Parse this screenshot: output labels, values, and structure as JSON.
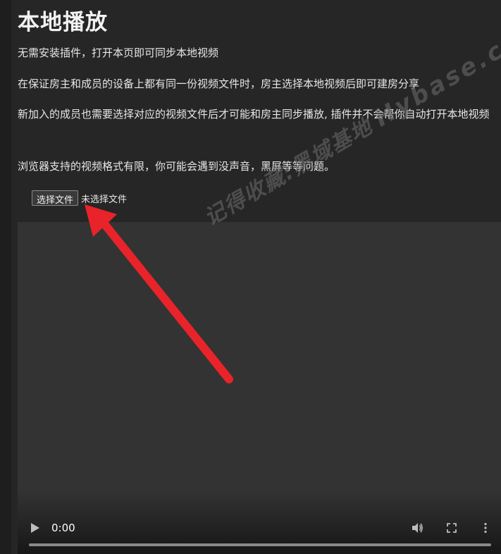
{
  "page": {
    "title": "本地播放",
    "paragraphs": [
      "无需安装插件，打开本页即可同步本地视频",
      "在保证房主和成员的设备上都有同一份视频文件时，房主选择本地视频后即可建房分享",
      "新加入的成员也需要选择对应的视频文件后才可能和房主同步播放, 插件并不会帮你自动打开本地视频",
      "浏览器支持的视频格式有限，你可能会遇到没声音，黑屏等等问题。"
    ]
  },
  "file_input": {
    "button_label": "选择文件",
    "status": "未选择文件"
  },
  "video": {
    "time": "0:00",
    "progress": 0,
    "controls": [
      "play-icon",
      "volume-icon",
      "fullscreen-icon",
      "more-options-icon"
    ]
  },
  "watermark": {
    "text": "记得收藏:黑域基地",
    "brand": "Hybase.com"
  },
  "colors": {
    "background": "#262626",
    "video_background": "#333333",
    "annotation_arrow": "#e8232a"
  }
}
